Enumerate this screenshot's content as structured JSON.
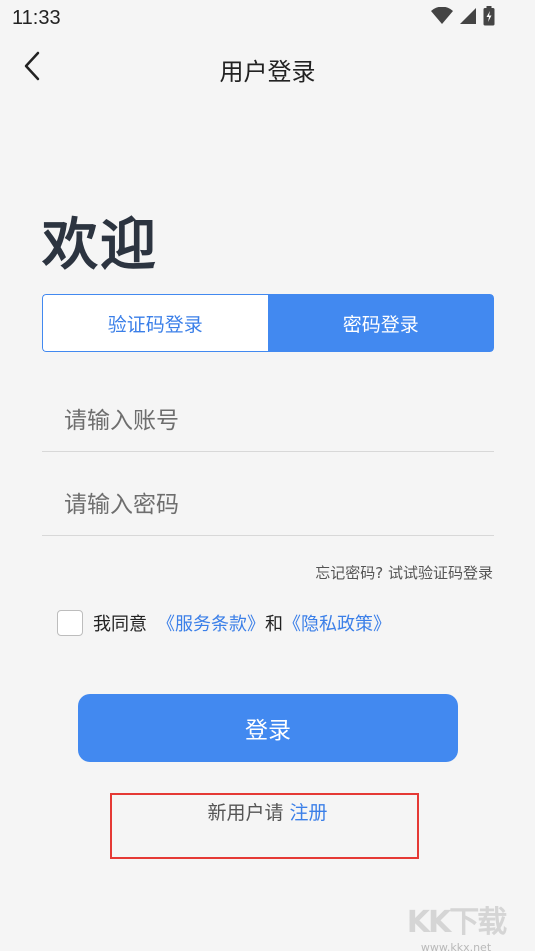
{
  "status_bar": {
    "time": "11:33",
    "icons": [
      "wifi-icon",
      "signal-icon",
      "battery-icon"
    ]
  },
  "header": {
    "title": "用户登录",
    "back_icon": "chevron-left-icon"
  },
  "welcome": "欢迎",
  "tabs": [
    {
      "label": "验证码登录",
      "active": false
    },
    {
      "label": "密码登录",
      "active": true
    }
  ],
  "form": {
    "account_placeholder": "请输入账号",
    "account_value": "",
    "password_placeholder": "请输入密码",
    "password_value": ""
  },
  "forgot_link": "忘记密码? 试试验证码登录",
  "agreement": {
    "checked": false,
    "prefix": "我同意",
    "terms": "《服务条款》",
    "and": "和",
    "privacy": "《隐私政策》"
  },
  "login_button": "登录",
  "register": {
    "prefix": "新用户请",
    "link": "注册"
  },
  "watermark": {
    "logo": "KK下载",
    "url": "www.kkx.net"
  },
  "colors": {
    "accent": "#4289f0",
    "link": "#3b7fe8",
    "highlight": "#e53935",
    "background": "#f5f5f5"
  }
}
